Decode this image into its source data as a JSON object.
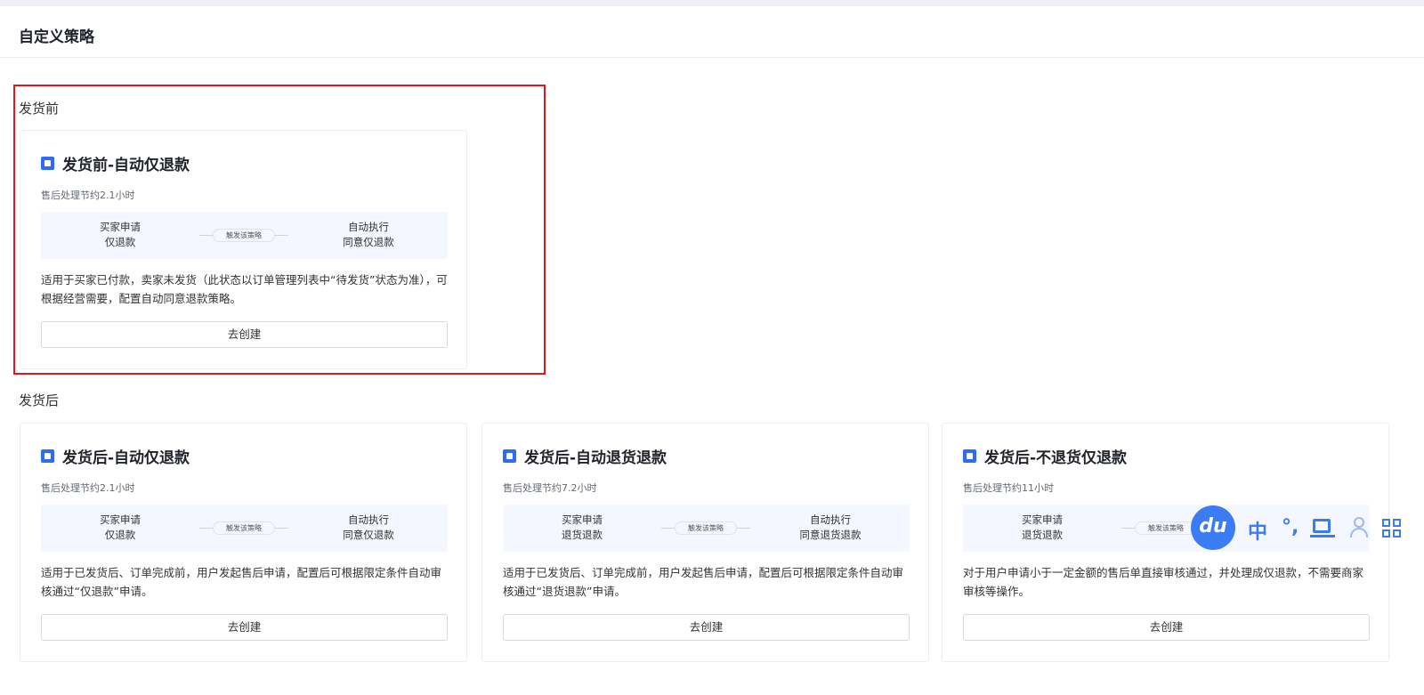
{
  "page": {
    "title": "自定义策略"
  },
  "sections": [
    {
      "label": "发货前"
    },
    {
      "label": "发货后"
    }
  ],
  "cards": [
    {
      "title": "发货前-自动仅退款",
      "savings": "售后处理节约2.1小时",
      "flow_left": [
        "买家申请",
        "仅退款"
      ],
      "flow_mid": "触发该策略",
      "flow_right": [
        "自动执行",
        "同意仅退款"
      ],
      "description": "适用于买家已付款，卖家未发货（此状态以订单管理列表中“待发货”状态为准），可根据经营需要，配置自动同意退款策略。",
      "button": "去创建"
    },
    {
      "title": "发货后-自动仅退款",
      "savings": "售后处理节约2.1小时",
      "flow_left": [
        "买家申请",
        "仅退款"
      ],
      "flow_mid": "触发该策略",
      "flow_right": [
        "自动执行",
        "同意仅退款"
      ],
      "description": "适用于已发货后、订单完成前，用户发起售后申请，配置后可根据限定条件自动审核通过“仅退款”申请。",
      "button": "去创建"
    },
    {
      "title": "发货后-自动退货退款",
      "savings": "售后处理节约7.2小时",
      "flow_left": [
        "买家申请",
        "退货退款"
      ],
      "flow_mid": "触发该策略",
      "flow_right": [
        "自动执行",
        "同意退货退款"
      ],
      "description": "适用于已发货后、订单完成前，用户发起售后申请，配置后可根据限定条件自动审核通过“退货退款”申请。",
      "button": "去创建"
    },
    {
      "title": "发货后-不退货仅退款",
      "savings": "售后处理节约11小时",
      "flow_left": [
        "买家申请",
        "退货退款"
      ],
      "flow_mid": "触发该策略",
      "flow_right": [
        "",
        ""
      ],
      "description": "对于用户申请小于一定金额的售后单直接审核通过，并处理成仅退款，不需要商家审核等操作。",
      "button": "去创建"
    }
  ],
  "ime_toolbar": {
    "logo": "du",
    "lang": "中",
    "punct": "°,",
    "icons": [
      "keyboard-icon",
      "user-icon",
      "grid-icon"
    ]
  }
}
